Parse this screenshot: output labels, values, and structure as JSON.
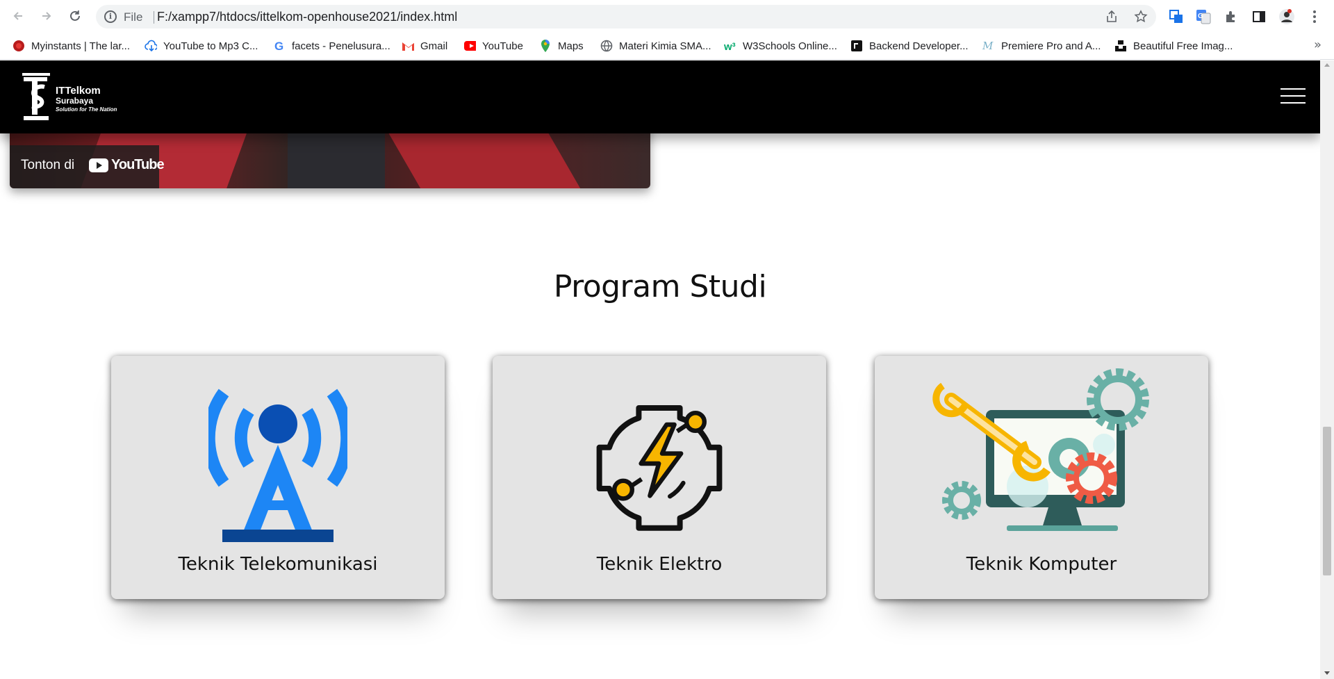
{
  "browser": {
    "nav": {
      "back_icon": "arrow-left-icon",
      "forward_icon": "arrow-right-icon",
      "reload_icon": "reload-icon"
    },
    "address": {
      "scheme": "File",
      "url": "F:/xampp7/htdocs/ittelkom-openhouse2021/index.html"
    },
    "bookmarks": [
      {
        "label": "Myinstants | The lar...",
        "icon": "myinstants-icon"
      },
      {
        "label": "YouTube to Mp3 C...",
        "icon": "cloud-download-icon"
      },
      {
        "label": "facets - Penelusura...",
        "icon": "google-icon"
      },
      {
        "label": "Gmail",
        "icon": "gmail-icon"
      },
      {
        "label": "YouTube",
        "icon": "youtube-icon"
      },
      {
        "label": "Maps",
        "icon": "maps-icon"
      },
      {
        "label": "Materi Kimia SMA...",
        "icon": "globe-icon"
      },
      {
        "label": "W3Schools Online...",
        "icon": "w3schools-icon"
      },
      {
        "label": "Backend Developer...",
        "icon": "roadmap-icon"
      },
      {
        "label": "Premiere Pro and A...",
        "icon": "premiere-icon"
      },
      {
        "label": "Beautiful Free Imag...",
        "icon": "unsplash-icon"
      }
    ],
    "bookmarks_overflow": "»"
  },
  "site": {
    "logo": {
      "line1": "ITTelkom",
      "line2": "Surabaya",
      "tagline": "Solution for The Nation"
    },
    "video": {
      "watch_label": "Tonton di",
      "platform": "YouTube"
    },
    "section_title": "Program Studi",
    "programs": [
      {
        "label": "Teknik Telekomunikasi",
        "icon": "antenna-tower-icon"
      },
      {
        "label": "Teknik Elektro",
        "icon": "electric-chip-icon"
      },
      {
        "label": "Teknik Komputer",
        "icon": "computer-gears-icon"
      }
    ],
    "colors": {
      "navbar": "#000000",
      "card": "#e4e4e4",
      "antenna_blue": "#1d86f5",
      "bolt_yellow": "#f7b500"
    }
  }
}
